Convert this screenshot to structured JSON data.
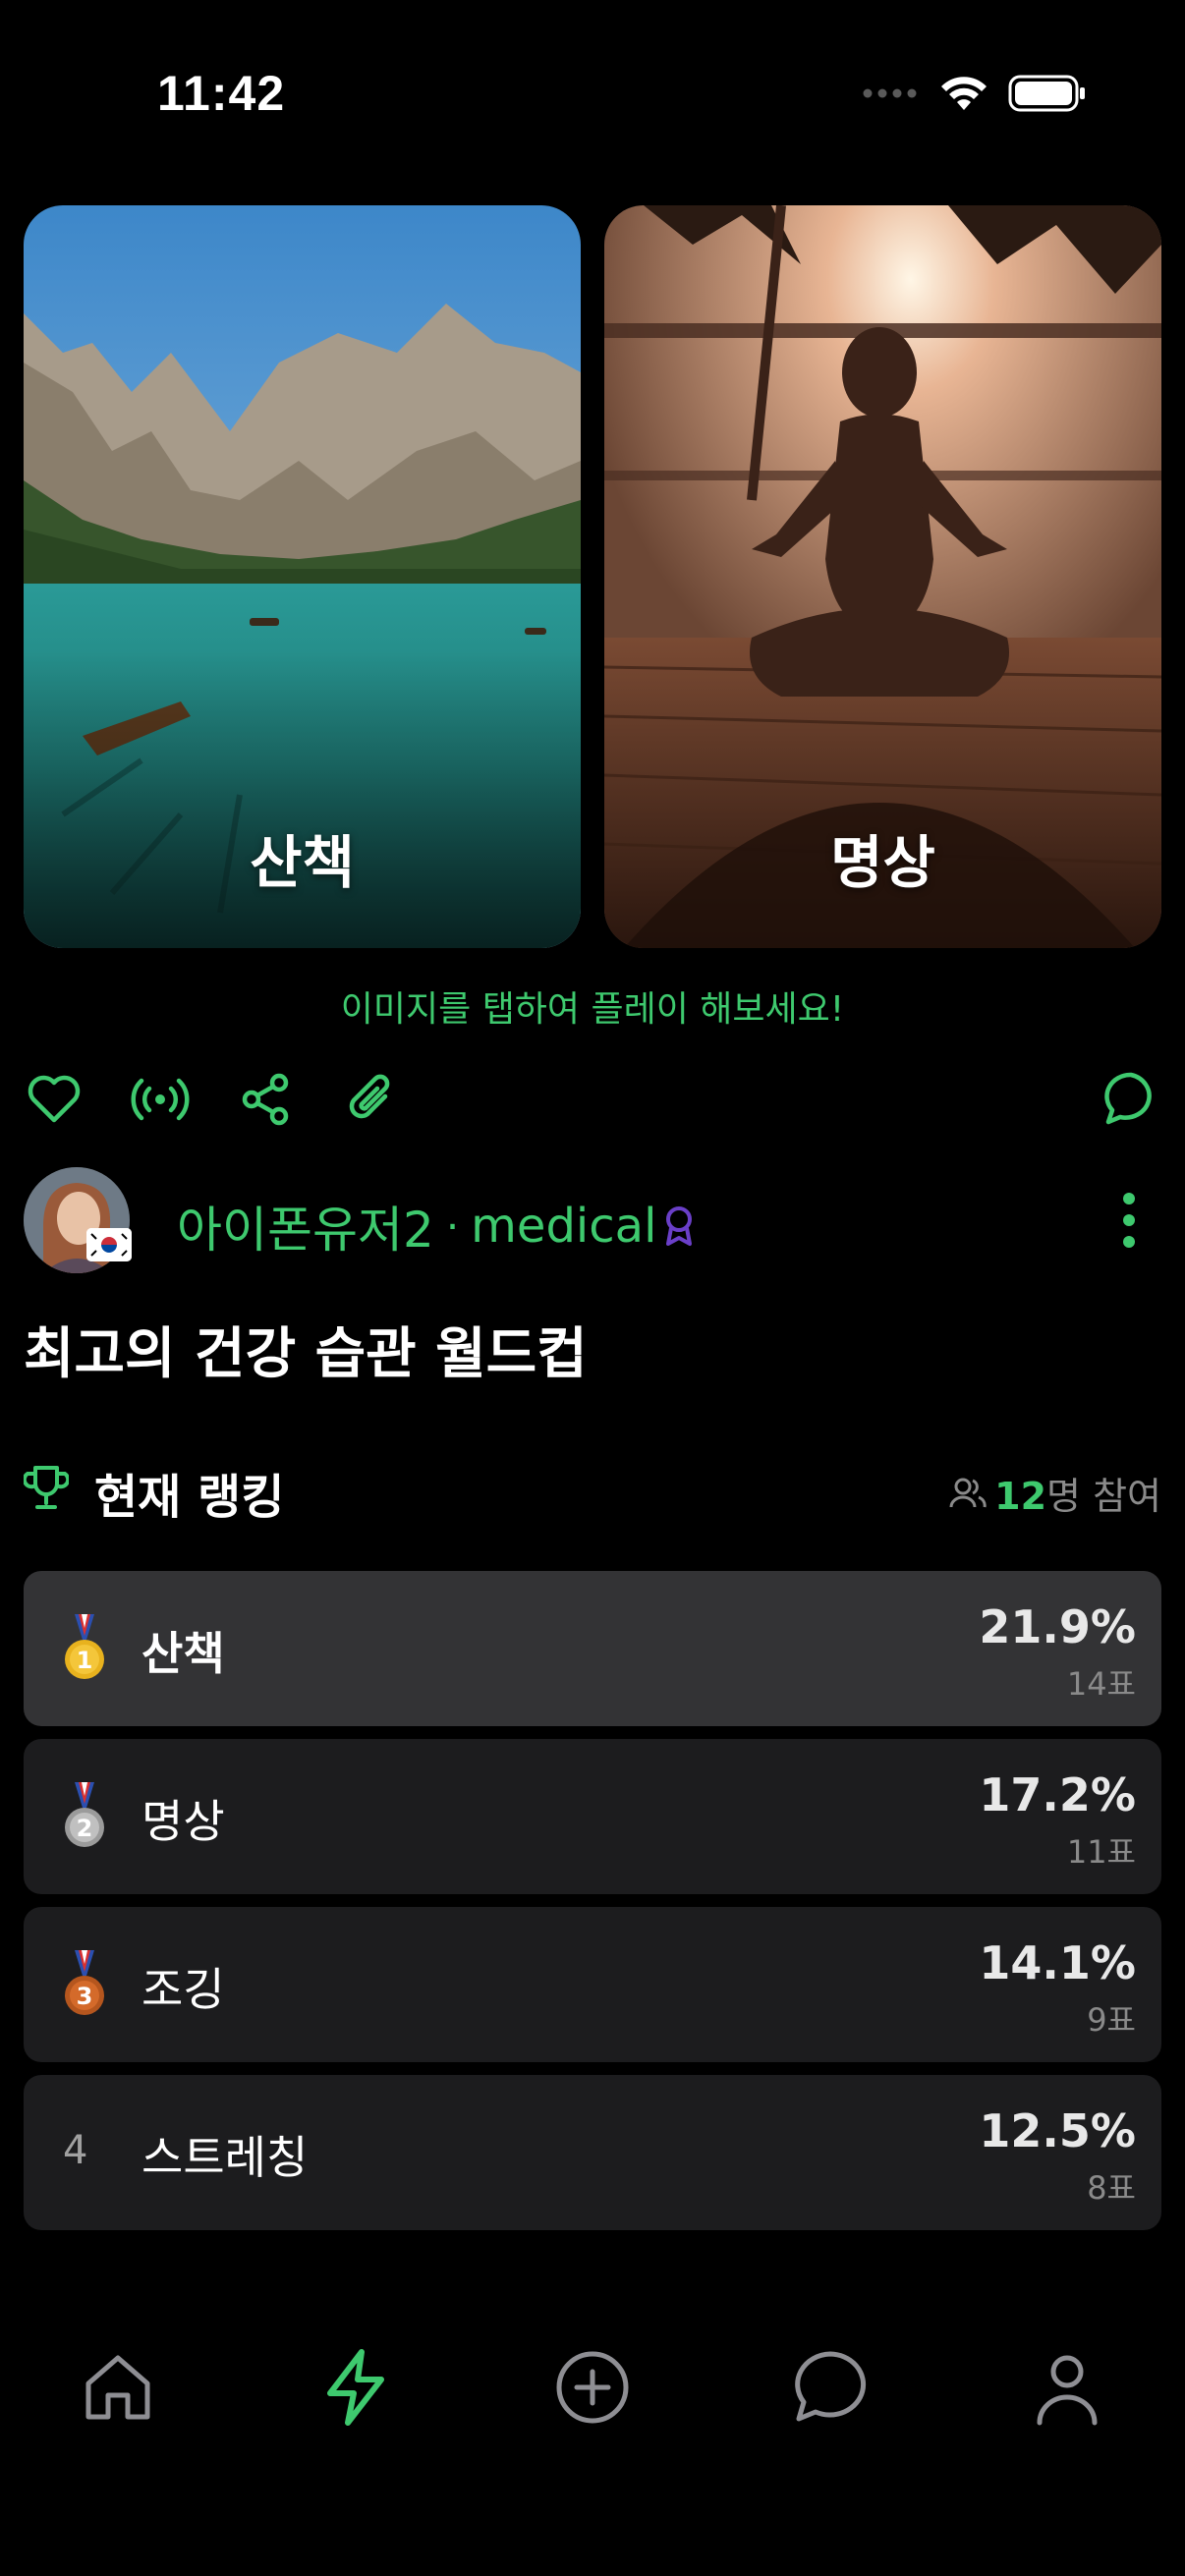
{
  "status_bar": {
    "time": "11:42"
  },
  "cards": [
    {
      "label": "산책"
    },
    {
      "label": "명상"
    }
  ],
  "hint": "이미지를 탭하여 플레이 해보세요!",
  "author": {
    "name": "아이폰유저2",
    "separator": "·",
    "category": "medical"
  },
  "post_title": "최고의 건강 습관 월드컵",
  "ranking": {
    "title": "현재 랭킹",
    "participants_count": "12",
    "participants_suffix": "명 참여",
    "items": [
      {
        "rank": "1",
        "name": "산책",
        "percent": "21.9%",
        "votes": "14표"
      },
      {
        "rank": "2",
        "name": "명상",
        "percent": "17.2%",
        "votes": "11표"
      },
      {
        "rank": "3",
        "name": "조깅",
        "percent": "14.1%",
        "votes": "9표"
      },
      {
        "rank": "4",
        "name": "스트레칭",
        "percent": "12.5%",
        "votes": "8표"
      }
    ]
  },
  "colors": {
    "accent": "#3ec96e",
    "badge": "#6a3fc8",
    "background": "#000000"
  },
  "tab_bar": [
    "home-icon",
    "lightning-icon",
    "plus-circle-icon",
    "chat-icon",
    "person-icon"
  ]
}
